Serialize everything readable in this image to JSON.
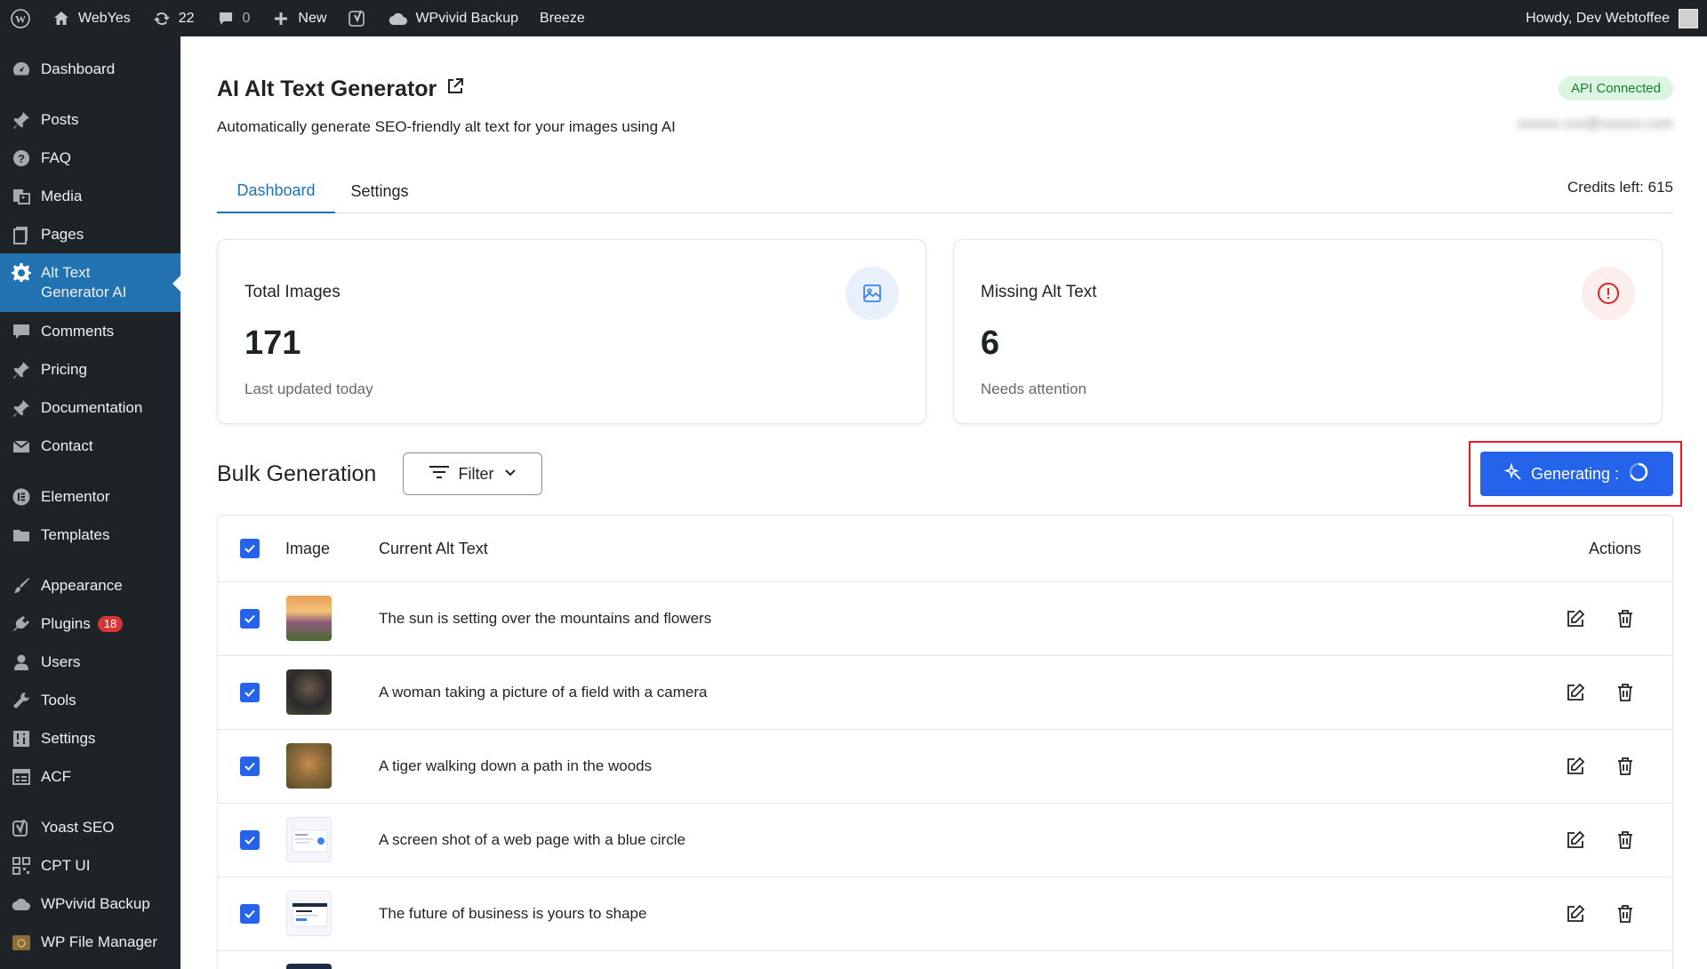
{
  "adminbar": {
    "site_name": "WebYes",
    "updates_count": "22",
    "comments_count": "0",
    "new_label": "New",
    "wpvivid_label": "WPvivid Backup",
    "breeze_label": "Breeze",
    "howdy": "Howdy, Dev Webtoffee"
  },
  "sidebar": {
    "items": [
      {
        "label": "Dashboard",
        "icon": "dashboard-icon"
      },
      {
        "label": "Posts",
        "icon": "pin-icon"
      },
      {
        "label": "FAQ",
        "icon": "question-icon"
      },
      {
        "label": "Media",
        "icon": "media-icon"
      },
      {
        "label": "Pages",
        "icon": "pages-icon"
      },
      {
        "label": "Alt Text Generator AI",
        "line1": "Alt Text",
        "line2": "Generator AI",
        "icon": "gear-icon"
      },
      {
        "label": "Comments",
        "icon": "comment-icon"
      },
      {
        "label": "Pricing",
        "icon": "pin-icon"
      },
      {
        "label": "Documentation",
        "icon": "pin-icon"
      },
      {
        "label": "Contact",
        "icon": "mail-icon"
      },
      {
        "label": "Elementor",
        "icon": "elementor-icon"
      },
      {
        "label": "Templates",
        "icon": "folder-icon"
      },
      {
        "label": "Appearance",
        "icon": "brush-icon"
      },
      {
        "label": "Plugins",
        "icon": "plugin-icon",
        "badge": "18"
      },
      {
        "label": "Users",
        "icon": "user-icon"
      },
      {
        "label": "Tools",
        "icon": "wrench-icon"
      },
      {
        "label": "Settings",
        "icon": "settings-icon"
      },
      {
        "label": "ACF",
        "icon": "grid-icon"
      },
      {
        "label": "Yoast SEO",
        "icon": "yoast-icon"
      },
      {
        "label": "CPT UI",
        "icon": "qr-icon"
      },
      {
        "label": "WPvivid Backup",
        "icon": "cloud-icon"
      },
      {
        "label": "WP File Manager",
        "icon": "file-manager-icon"
      }
    ]
  },
  "header": {
    "title": "AI Alt Text Generator",
    "subtitle": "Automatically generate SEO-friendly alt text for your images using AI",
    "api_status": "API Connected",
    "account_email": "xxxxxx.xxx@xxxxxx.com"
  },
  "tabs": [
    {
      "label": "Dashboard",
      "active": true
    },
    {
      "label": "Settings",
      "active": false
    }
  ],
  "credits": "Credits left: 615",
  "cards": {
    "total": {
      "title": "Total Images",
      "value": "171",
      "sub": "Last updated today",
      "icon": "image-icon"
    },
    "missing": {
      "title": "Missing Alt Text",
      "value": "6",
      "sub": "Needs attention",
      "icon": "alert-icon"
    }
  },
  "bulk": {
    "title": "Bulk Generation",
    "filter_label": "Filter",
    "generate_label": "Generating :"
  },
  "table": {
    "headers": {
      "image": "Image",
      "alt": "Current Alt Text",
      "actions": "Actions"
    },
    "rows": [
      {
        "alt": "The sun is setting over the mountains and flowers"
      },
      {
        "alt": "A woman taking a picture of a field with a camera"
      },
      {
        "alt": "A tiger walking down a path in the woods"
      },
      {
        "alt": "A screen shot of a web page with a blue circle"
      },
      {
        "alt": "The future of business is yours to shape"
      }
    ]
  },
  "colors": {
    "admin_dark": "#1d2327",
    "wp_blue": "#2271b1",
    "primary": "#2563eb",
    "highlight": "#e4191f",
    "success_bg": "#dcf5e3",
    "success_text": "#1a7f37"
  }
}
